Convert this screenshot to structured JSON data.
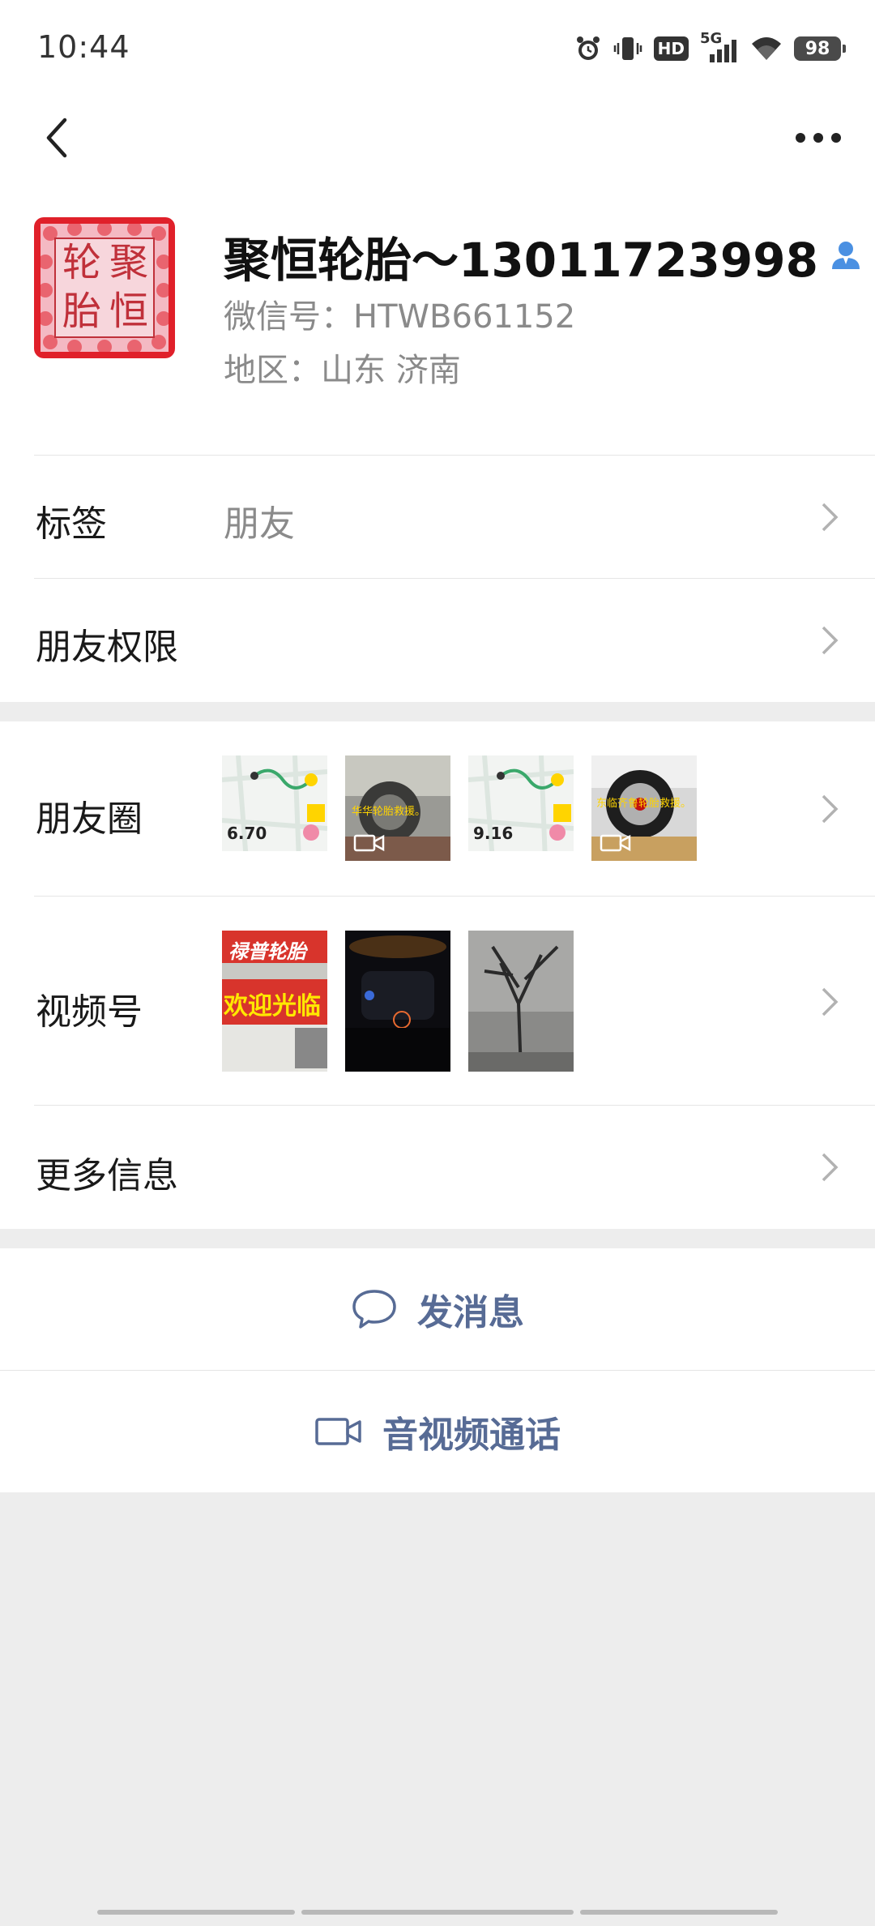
{
  "status": {
    "time": "10:44",
    "hd": "HD",
    "net": "5G",
    "battery": "98"
  },
  "profile": {
    "avatar_chars": [
      "轮",
      "聚",
      "胎",
      "恒"
    ],
    "name": "聚恒轮胎～13011723998",
    "wechat_id": "微信号：HTWB661152",
    "region": "地区：山东  济南"
  },
  "rows": {
    "tag_label": "标签",
    "tag_value": "朋友",
    "permission_label": "朋友权限",
    "moments_label": "朋友圈",
    "channels_label": "视频号",
    "more_info_label": "更多信息"
  },
  "moments": [
    {
      "kind": "map",
      "number": "6.70"
    },
    {
      "kind": "video",
      "overlay_text": "华华轮胎救援。"
    },
    {
      "kind": "map",
      "number": "9.16"
    },
    {
      "kind": "video",
      "overlay_text": "东临齐鲁轮胎救援。"
    }
  ],
  "channels": [
    {
      "kind": "storefront",
      "sign_top": "禄普轮胎",
      "sign_main": "欢迎光临"
    },
    {
      "kind": "night-car"
    },
    {
      "kind": "tree"
    }
  ],
  "actions": {
    "message": "发消息",
    "call": "音视频通话"
  },
  "colors": {
    "link": "#576b95",
    "background": "#ededed",
    "secondary_text": "#8a8a8a",
    "avatar_red": "#e0202a"
  }
}
